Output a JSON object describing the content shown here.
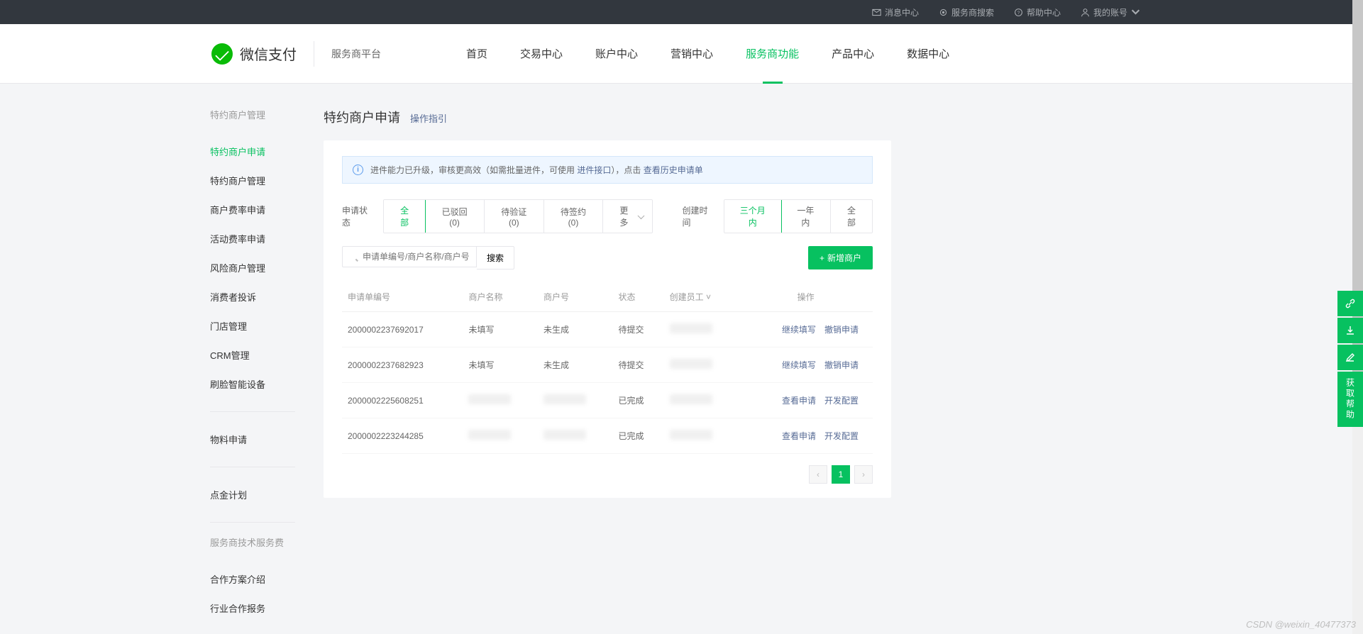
{
  "topbar": {
    "msg": "消息中心",
    "search": "服务商搜索",
    "help": "帮助中心",
    "account": "我的账号"
  },
  "header": {
    "logo_text": "微信支付",
    "platform": "服务商平台",
    "nav": [
      "首页",
      "交易中心",
      "账户中心",
      "营销中心",
      "服务商功能",
      "产品中心",
      "数据中心"
    ],
    "nav_active_index": 4
  },
  "sidebar": {
    "group1_title": "特约商户管理",
    "group1_items": [
      "特约商户申请",
      "特约商户管理",
      "商户费率申请",
      "活动费率申请",
      "风险商户管理",
      "消费者投诉",
      "门店管理",
      "CRM管理",
      "刷脸智能设备"
    ],
    "group2_items": [
      "物料申请"
    ],
    "group3_items": [
      "点金计划"
    ],
    "group4_title": "服务商技术服务费",
    "group4_items": [
      "合作方案介绍",
      "行业合作报务"
    ],
    "active": "特约商户申请"
  },
  "page": {
    "title": "特约商户申请",
    "guide": "操作指引"
  },
  "banner": {
    "t1": "进件能力已升级，审核更高效（如需批量进件，可使用 ",
    "link1": "进件接口",
    "t2": "），点击 ",
    "link2": "查看历史申请单"
  },
  "filters": {
    "status_label": "申请状态",
    "status_tabs": [
      "全部",
      "已驳回(0)",
      "待验证(0)",
      "待签约(0)",
      "更多"
    ],
    "time_label": "创建时间",
    "time_tabs": [
      "三个月内",
      "一年内",
      "全部"
    ]
  },
  "search": {
    "placeholder": "申请单编号/商户名称/商户号",
    "btn": "搜索",
    "add_btn": "新增商户"
  },
  "table": {
    "headers": [
      "申请单编号",
      "商户名称",
      "商户号",
      "状态",
      "创建员工",
      "操作"
    ],
    "rows": [
      {
        "id": "2000002237692017",
        "name": "未填写",
        "mch": "未生成",
        "status": "待提交",
        "staff_blur": true,
        "actions": [
          "继续填写",
          "撤销申请"
        ]
      },
      {
        "id": "2000002237682923",
        "name": "未填写",
        "mch": "未生成",
        "status": "待提交",
        "staff_blur": true,
        "actions": [
          "继续填写",
          "撤销申请"
        ]
      },
      {
        "id": "2000002225608251",
        "name_blur": true,
        "mch_blur": true,
        "status": "已完成",
        "staff_blur": true,
        "actions": [
          "查看申请",
          "开发配置"
        ]
      },
      {
        "id": "2000002223244285",
        "name_blur": true,
        "mch_blur": true,
        "status": "已完成",
        "staff_blur": true,
        "actions": [
          "查看申请",
          "开发配置"
        ]
      }
    ]
  },
  "pagination": {
    "current": "1"
  },
  "float": {
    "help": "获取帮助"
  },
  "watermark": "CSDN @weixin_40477373"
}
